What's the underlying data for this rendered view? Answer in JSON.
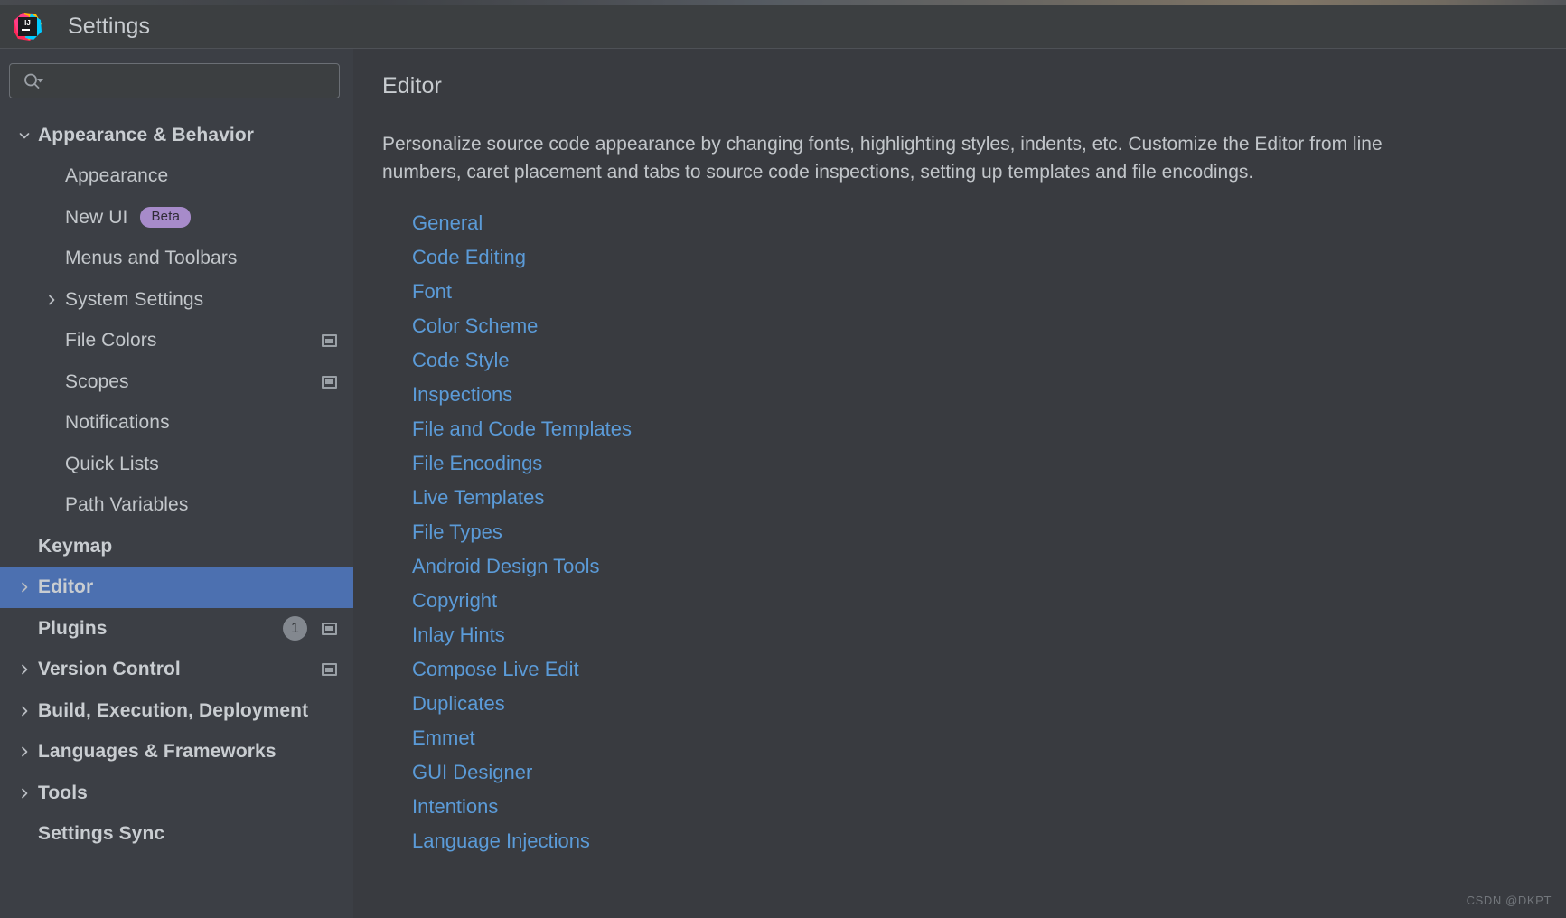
{
  "window": {
    "title": "Settings",
    "logo_icon": "intellij-idea-logo"
  },
  "search": {
    "placeholder": "",
    "value": "",
    "icon": "search-icon",
    "dropdown_icon": "triangle-down-icon"
  },
  "sidebar": {
    "items": [
      {
        "label": "Appearance & Behavior",
        "level": 0,
        "bold": true,
        "twisty": "chevron-down-icon",
        "selected": false
      },
      {
        "label": "Appearance",
        "level": 1,
        "bold": false,
        "twisty": "none",
        "selected": false
      },
      {
        "label": "New UI",
        "level": 1,
        "bold": false,
        "twisty": "none",
        "selected": false,
        "badge": "Beta"
      },
      {
        "label": "Menus and Toolbars",
        "level": 1,
        "bold": false,
        "twisty": "none",
        "selected": false
      },
      {
        "label": "System Settings",
        "level": 1,
        "bold": false,
        "twisty": "chevron-right-icon",
        "selected": false
      },
      {
        "label": "File Colors",
        "level": 1,
        "bold": false,
        "twisty": "none",
        "selected": false,
        "right_icon": "settings-rect-icon"
      },
      {
        "label": "Scopes",
        "level": 1,
        "bold": false,
        "twisty": "none",
        "selected": false,
        "right_icon": "settings-rect-icon"
      },
      {
        "label": "Notifications",
        "level": 1,
        "bold": false,
        "twisty": "none",
        "selected": false
      },
      {
        "label": "Quick Lists",
        "level": 1,
        "bold": false,
        "twisty": "none",
        "selected": false
      },
      {
        "label": "Path Variables",
        "level": 1,
        "bold": false,
        "twisty": "none",
        "selected": false
      },
      {
        "label": "Keymap",
        "level": 0,
        "bold": true,
        "twisty": "none",
        "selected": false
      },
      {
        "label": "Editor",
        "level": 0,
        "bold": true,
        "twisty": "chevron-right-icon",
        "selected": true
      },
      {
        "label": "Plugins",
        "level": 0,
        "bold": true,
        "twisty": "none",
        "selected": false,
        "count": "1",
        "right_icon": "settings-rect-icon"
      },
      {
        "label": "Version Control",
        "level": 0,
        "bold": true,
        "twisty": "chevron-right-icon",
        "selected": false,
        "right_icon": "settings-rect-icon"
      },
      {
        "label": "Build, Execution, Deployment",
        "level": 0,
        "bold": true,
        "twisty": "chevron-right-icon",
        "selected": false
      },
      {
        "label": "Languages & Frameworks",
        "level": 0,
        "bold": true,
        "twisty": "chevron-right-icon",
        "selected": false
      },
      {
        "label": "Tools",
        "level": 0,
        "bold": true,
        "twisty": "chevron-right-icon",
        "selected": false
      },
      {
        "label": "Settings Sync",
        "level": 0,
        "bold": true,
        "twisty": "none",
        "selected": false
      }
    ]
  },
  "main": {
    "title": "Editor",
    "description": "Personalize source code appearance by changing fonts, highlighting styles, indents, etc. Customize the Editor from line\nnumbers, caret placement and tabs to source code inspections, setting up templates and file encodings.",
    "links": [
      "General",
      "Code Editing",
      "Font",
      "Color Scheme",
      "Code Style",
      "Inspections",
      "File and Code Templates",
      "File Encodings",
      "Live Templates",
      "File Types",
      "Android Design Tools",
      "Copyright",
      "Inlay Hints",
      "Compose Live Edit",
      "Duplicates",
      "Emmet",
      "GUI Designer",
      "Intentions",
      "Language Injections"
    ]
  },
  "watermark": {
    "text": "CSDN @DKPT"
  },
  "colors": {
    "selection": "#4c70b0",
    "link": "#5b9bd8",
    "badge_beta": "#a78bca",
    "sidebar_bg": "#3c3f45",
    "content_bg": "#393b40",
    "titlebar_bg": "#3c3f41"
  }
}
